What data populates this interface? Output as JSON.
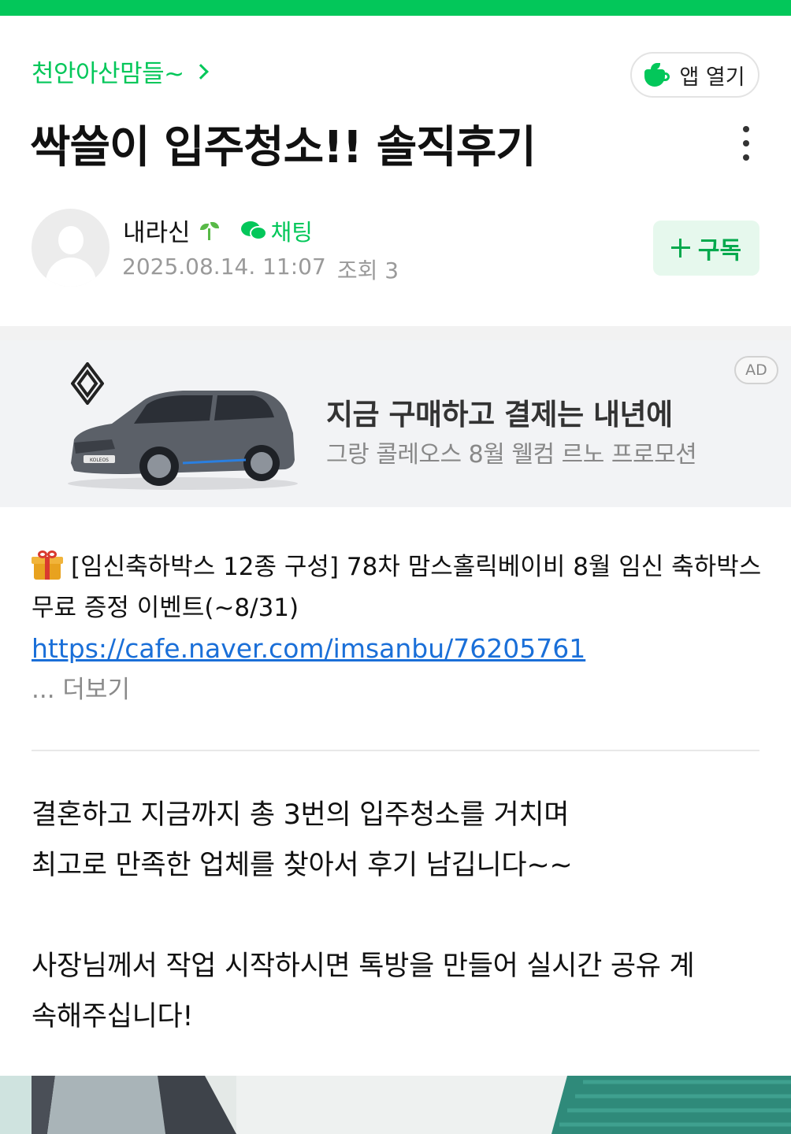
{
  "header": {
    "cafe_name": "천안아산맘들~",
    "app_open_label": "앱 열기"
  },
  "post": {
    "title": "싹쓸이 입주청소!! 솔직후기",
    "author": "내라신",
    "chat_label": "채팅",
    "date": "2025.08.14. 11:07",
    "views": "조회 3",
    "subscribe_label": "구독"
  },
  "ad": {
    "badge": "AD",
    "headline": "지금 구매하고 결제는 내년에",
    "subline": "그랑 콜레오스 8월 웰컴 르노 프로모션",
    "car_plate": "KOLEOS"
  },
  "notice": {
    "text": "[임신축하박스 12종 구성] 78차 맘스홀릭베이비 8월 임신 축하박스 무료 증정 이벤트(~8/31)",
    "link": "https://cafe.naver.com/imsanbu/76205761",
    "more_label": "... 더보기"
  },
  "body": {
    "paragraph1_line1": "결혼하고 지금까지 총 3번의 입주청소를 거치며",
    "paragraph1_line2": "최고로 만족한 업체를 찾아서 후기 남깁니다~~",
    "paragraph2_line1": "사장님께서 작업 시작하시면 톡방을 만들어 실시간 공유 계",
    "paragraph2_line2": "속해주십니다!"
  },
  "colors": {
    "brand_green": "#03c75a",
    "link_blue": "#1a6fd8"
  },
  "icons": [
    "chevron-right-icon",
    "coffee-cup-icon",
    "more-vertical-icon",
    "sprout-icon",
    "chat-bubble-icon",
    "plus-icon",
    "gift-icon",
    "renault-logo"
  ]
}
